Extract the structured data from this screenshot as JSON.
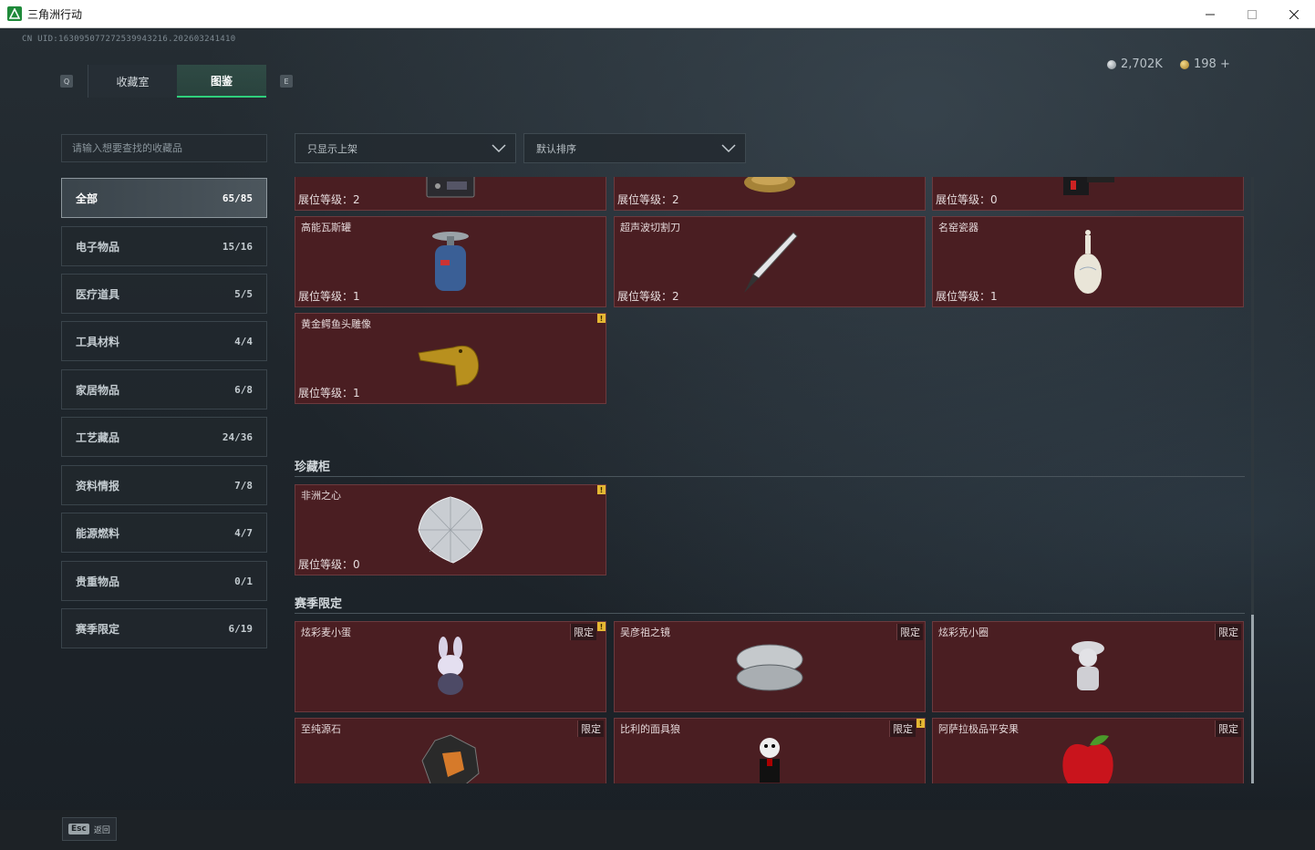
{
  "window": {
    "title": "三角洲行动",
    "minimize": "—",
    "maximize": "☐",
    "close": "✕"
  },
  "header": {
    "uid": "CN UID:16309507727253994321​6.202603241410",
    "currency": [
      {
        "value": "2,702K"
      },
      {
        "value": "198 +"
      }
    ]
  },
  "tabs": {
    "left_key": "Q",
    "right_key": "E",
    "items": [
      {
        "label": "收藏室"
      },
      {
        "label": "图鉴"
      }
    ],
    "active": "图鉴"
  },
  "search": {
    "placeholder": "请输入想要查找的收藏品"
  },
  "filters": {
    "filter": "只显示上架",
    "sort": "默认排序"
  },
  "sidebar": {
    "items": [
      {
        "label": "全部",
        "count": "65/85",
        "active": true
      },
      {
        "label": "电子物品",
        "count": "15/16"
      },
      {
        "label": "医疗道具",
        "count": "5/5"
      },
      {
        "label": "工具材料",
        "count": "4/4"
      },
      {
        "label": "家居物品",
        "count": "6/8"
      },
      {
        "label": "工艺藏品",
        "count": "24/36"
      },
      {
        "label": "资料情报",
        "count": "7/8"
      },
      {
        "label": "能源燃料",
        "count": "4/7"
      },
      {
        "label": "贵重物品",
        "count": "0/1"
      },
      {
        "label": "赛季限定",
        "count": "6/19"
      }
    ]
  },
  "grid": {
    "top_row": [
      {
        "level": "展位等级：2",
        "icon": "electronic-box-icon"
      },
      {
        "level": "展位等级：2",
        "icon": "golden-nest-icon"
      },
      {
        "level": "展位等级：0",
        "icon": "black-device-icon"
      }
    ],
    "row2": [
      {
        "name": "高能瓦斯罐",
        "level": "展位等级：1",
        "icon": "gas-canister-icon"
      },
      {
        "name": "超声波切割刀",
        "level": "展位等级：2",
        "icon": "ultrasonic-knife-icon"
      },
      {
        "name": "名窑瓷器",
        "level": "展位等级：1",
        "icon": "porcelain-vase-icon"
      }
    ],
    "row3": [
      {
        "name": "黄金鳄鱼头雕像",
        "level": "展位等级：1",
        "badge": "!",
        "icon": "golden-crocodile-icon"
      }
    ]
  },
  "sections": {
    "treasure": {
      "title": "珍藏柜",
      "items": [
        {
          "name": "非洲之心",
          "level": "展位等级：0",
          "badge": "!",
          "icon": "diamond-icon"
        }
      ]
    },
    "season": {
      "title": "赛季限定",
      "limited_label": "限定",
      "items": [
        {
          "name": "炫彩麦小蛋",
          "badge": "!",
          "icon": "bunny-egg-icon"
        },
        {
          "name": "吴彦祖之镜",
          "icon": "compact-mirror-icon"
        },
        {
          "name": "炫彩克小圈",
          "icon": "figurine-icon"
        },
        {
          "name": "至纯源石",
          "icon": "source-stone-icon"
        },
        {
          "name": "比利的面具狼",
          "badge": "!",
          "icon": "puppet-icon"
        },
        {
          "name": "阿萨拉极品平安果",
          "icon": "red-apple-icon"
        }
      ]
    }
  },
  "footer": {
    "esc_key": "Esc",
    "esc_label": "返回"
  },
  "colors": {
    "card_bg": "#4a1e22",
    "accent": "#2fd07c",
    "badge": "#e5b833"
  }
}
